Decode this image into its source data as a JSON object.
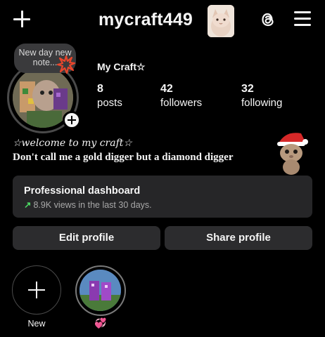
{
  "header": {
    "username": "mycraft449"
  },
  "note": {
    "text": "New day new note..."
  },
  "profile": {
    "display_name": "My Craft☆",
    "stats": [
      {
        "value": "8",
        "label": "posts"
      },
      {
        "value": "42",
        "label": "followers"
      },
      {
        "value": "32",
        "label": "following"
      }
    ],
    "bio_line1": "☆welcome to my craft☆",
    "bio_line2": "Don't call me a gold digger but a diamond digger"
  },
  "dashboard": {
    "title": "Professional dashboard",
    "subtitle_arrow": "↗",
    "subtitle": "8.9K views in the last 30 days."
  },
  "buttons": {
    "edit": "Edit profile",
    "share": "Share profile"
  },
  "highlights": {
    "new_label": "New",
    "items": [
      {
        "label": "💞"
      }
    ]
  },
  "icons": {
    "top_left": "plus-icon",
    "threads": "threads-icon",
    "menu": "hamburger-menu-icon",
    "note_sticker": "burst-icon",
    "dashboard_trend": "trend-up-arrow-icon",
    "highlight_new": "plus-icon"
  },
  "colors": {
    "background": "#000000",
    "card": "#262628",
    "button": "#2c2c2e",
    "trend_green": "#4cd964",
    "highlight_heart": "#d64bb0"
  }
}
